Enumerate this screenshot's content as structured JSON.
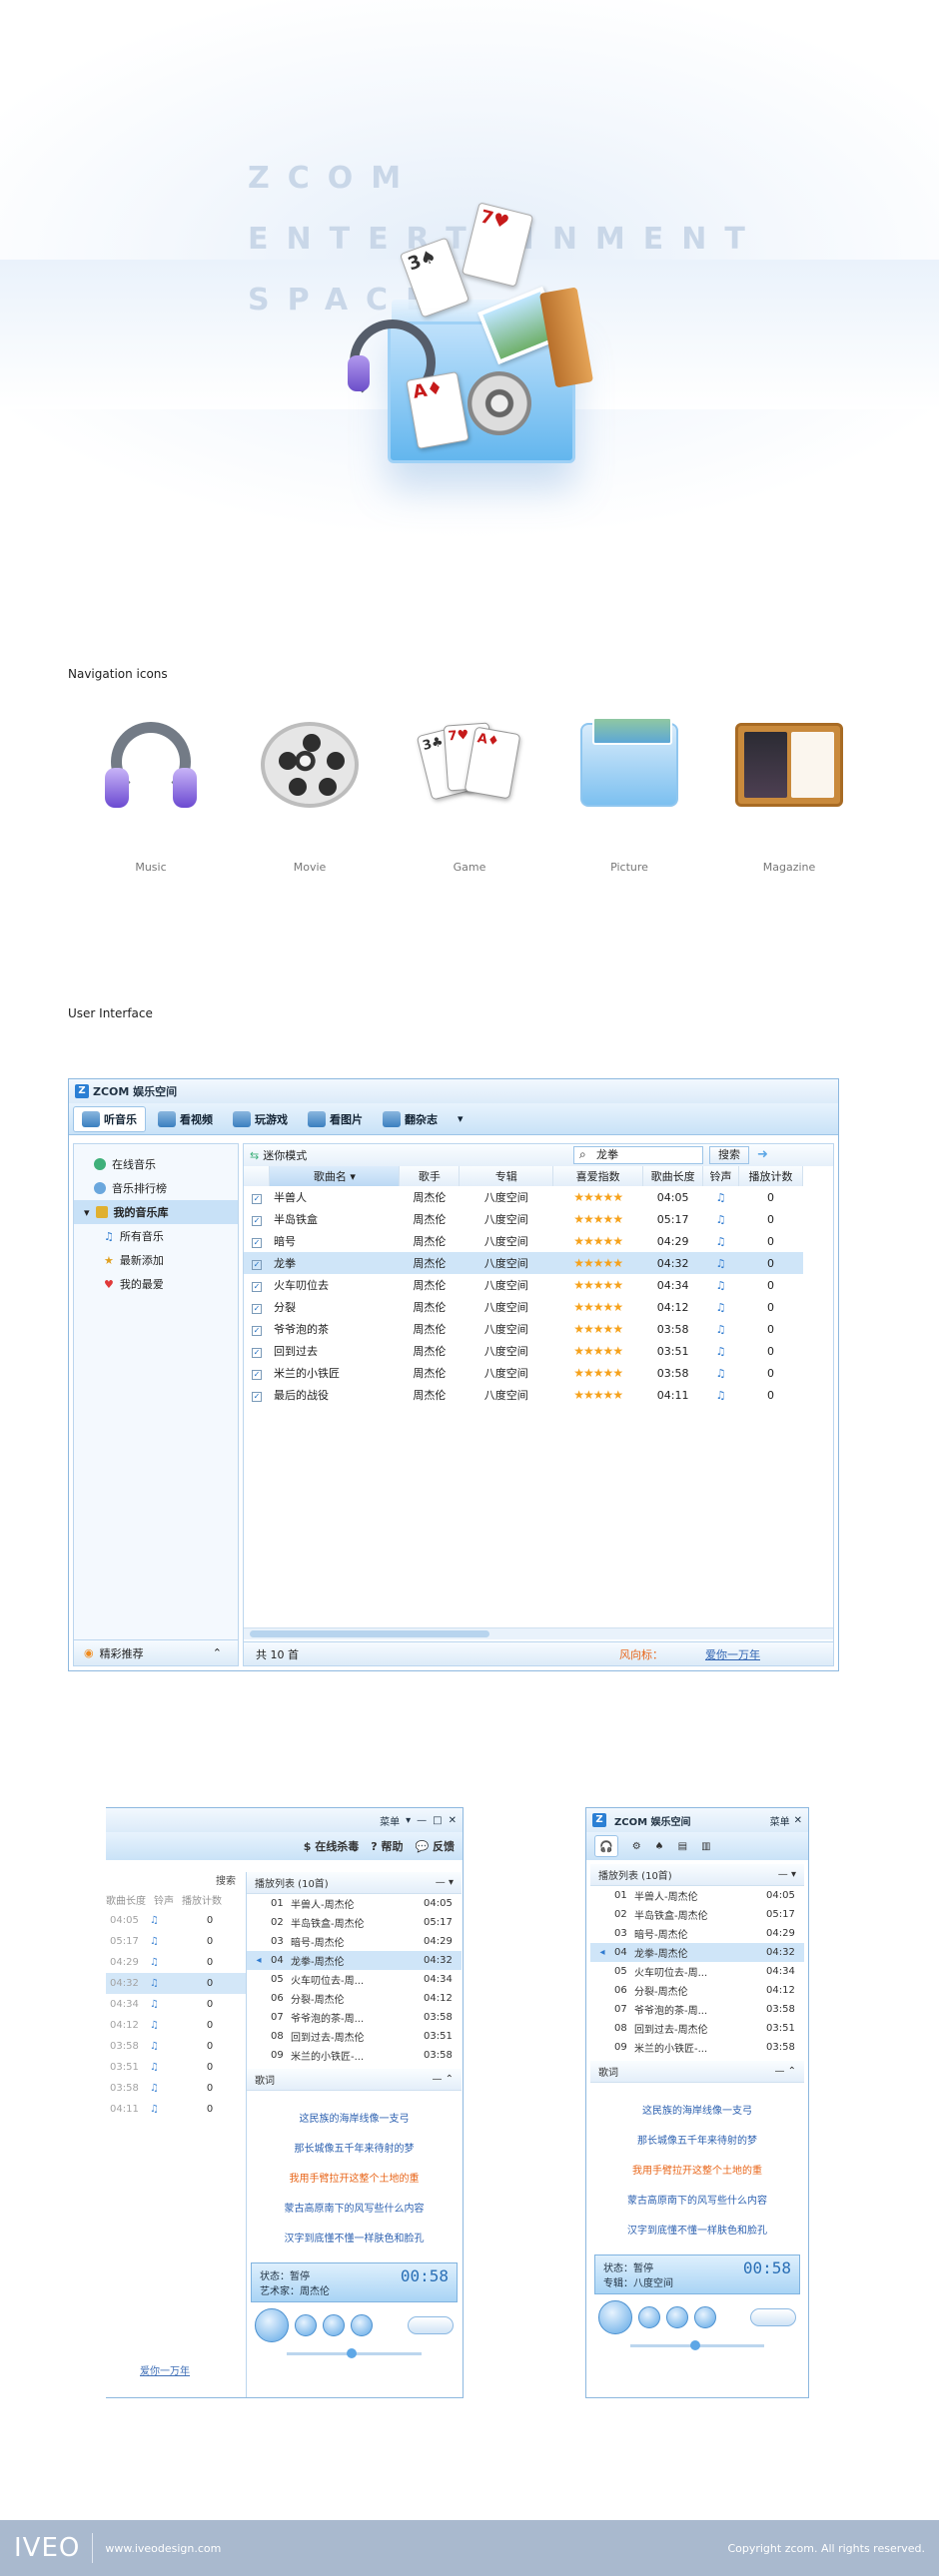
{
  "hero": {
    "line1": "ZCOM",
    "line2": "ENTERTAINMENT",
    "line3": "SPACE"
  },
  "sections": {
    "nav_title": "Navigation icons",
    "ui_title": "User Interface"
  },
  "nav_icons": [
    {
      "label": "Music",
      "icon": "headphones-icon"
    },
    {
      "label": "Movie",
      "icon": "film-reel-icon"
    },
    {
      "label": "Game",
      "icon": "playing-cards-icon"
    },
    {
      "label": "Picture",
      "icon": "photo-stack-icon"
    },
    {
      "label": "Magazine",
      "icon": "magazine-icon"
    }
  ],
  "window": {
    "title": "ZCOM 娱乐空间",
    "tabs": [
      "听音乐",
      "看视频",
      "玩游戏",
      "看图片",
      "翻杂志"
    ],
    "sidebar": {
      "items": [
        "在线音乐",
        "音乐排行榜"
      ],
      "group": "我的音乐库",
      "sub_items": [
        "所有音乐",
        "最新添加",
        "我的最爱"
      ],
      "footer": "精彩推荐"
    },
    "toolbar": {
      "mini_mode": "迷你模式",
      "search_value": "龙拳",
      "search_button": "搜索"
    },
    "columns": [
      "歌曲名",
      "歌手",
      "专辑",
      "喜爱指数",
      "歌曲长度",
      "铃声",
      "播放计数"
    ],
    "songs": [
      {
        "name": "半兽人",
        "artist": "周杰伦",
        "album": "八度空间",
        "rating": "★★★★★",
        "length": "04:05",
        "ringtone": "♫",
        "plays": "0"
      },
      {
        "name": "半岛铁盒",
        "artist": "周杰伦",
        "album": "八度空间",
        "rating": "★★★★★",
        "length": "05:17",
        "ringtone": "♫",
        "plays": "0"
      },
      {
        "name": "暗号",
        "artist": "周杰伦",
        "album": "八度空间",
        "rating": "★★★★★",
        "length": "04:29",
        "ringtone": "♫",
        "plays": "0"
      },
      {
        "name": "龙拳",
        "artist": "周杰伦",
        "album": "八度空间",
        "rating": "★★★★★",
        "length": "04:32",
        "ringtone": "♫",
        "plays": "0"
      },
      {
        "name": "火车叨位去",
        "artist": "周杰伦",
        "album": "八度空间",
        "rating": "★★★★★",
        "length": "04:34",
        "ringtone": "♫",
        "plays": "0"
      },
      {
        "name": "分裂",
        "artist": "周杰伦",
        "album": "八度空间",
        "rating": "★★★★★",
        "length": "04:12",
        "ringtone": "♫",
        "plays": "0"
      },
      {
        "name": "爷爷泡的茶",
        "artist": "周杰伦",
        "album": "八度空间",
        "rating": "★★★★★",
        "length": "03:58",
        "ringtone": "♫",
        "plays": "0"
      },
      {
        "name": "回到过去",
        "artist": "周杰伦",
        "album": "八度空间",
        "rating": "★★★★★",
        "length": "03:51",
        "ringtone": "♫",
        "plays": "0"
      },
      {
        "name": "米兰的小铁匠",
        "artist": "周杰伦",
        "album": "八度空间",
        "rating": "★★★★★",
        "length": "03:58",
        "ringtone": "♫",
        "plays": "0"
      },
      {
        "name": "最后的战役",
        "artist": "周杰伦",
        "album": "八度空间",
        "rating": "★★★★★",
        "length": "04:11",
        "ringtone": "♫",
        "plays": "0"
      }
    ],
    "status": {
      "count": "共 10 首",
      "wind_label": "风向标：",
      "wind_link": "爱你一万年"
    }
  },
  "mini": {
    "menu": "菜单",
    "toolbar": {
      "antivirus": "在线杀毒",
      "help": "帮助",
      "feedback": "反馈"
    },
    "search_button": "搜索",
    "partial_columns": [
      "歌曲长度",
      "铃声",
      "播放计数"
    ],
    "playlist_title": "播放列表 (10首)",
    "playlist": [
      {
        "num": "01",
        "title": "半兽人-周杰伦",
        "time": "04:05"
      },
      {
        "num": "02",
        "title": "半岛铁盒-周杰伦",
        "time": "05:17"
      },
      {
        "num": "03",
        "title": "暗号-周杰伦",
        "time": "04:29"
      },
      {
        "num": "04",
        "title": "龙拳-周杰伦",
        "time": "04:32"
      },
      {
        "num": "05",
        "title": "火车叨位去-周...",
        "time": "04:34"
      },
      {
        "num": "06",
        "title": "分裂-周杰伦",
        "time": "04:12"
      },
      {
        "num": "07",
        "title": "爷爷泡的茶-周...",
        "time": "03:58"
      },
      {
        "num": "08",
        "title": "回到过去-周杰伦",
        "time": "03:51"
      },
      {
        "num": "09",
        "title": "米兰的小铁匠-...",
        "time": "03:58"
      }
    ],
    "lyrics_title": "歌词",
    "lyrics": [
      "这民族的海岸线像一支弓",
      "那长城像五千年来待射的梦",
      "我用手臂拉开这整个土地的重",
      "蒙古高原南下的风写些什么内容",
      "汉字到底懂不懂一样肤色和脸孔"
    ],
    "status": "状态：暂停",
    "artist": "艺术家：周杰伦",
    "album": "专辑：八度空间",
    "time": "00:58",
    "wind_link": "爱你一万年"
  },
  "footer": {
    "brand": "IVEO",
    "url": "www.iveodesign.com",
    "copyright": "Copyright zcom. All rights reserved."
  }
}
